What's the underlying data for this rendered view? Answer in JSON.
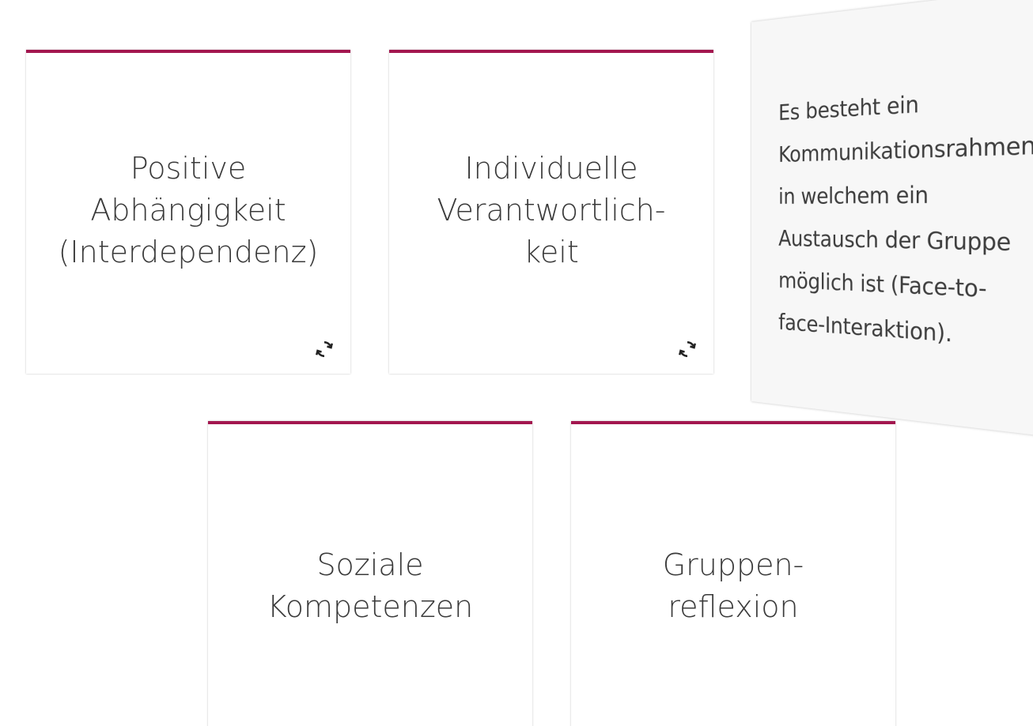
{
  "cards": [
    {
      "title": "Positive\nAbhängigkeit\n(Interdependenz)",
      "flip_icon": "refresh-icon"
    },
    {
      "title": "Individuelle\nVerantwortlich-\nkeit",
      "flip_icon": "refresh-icon"
    },
    {
      "back_text": "Es besteht ein Kommunikationsrahmen, in welchem ein Austausch der Gruppe möglich ist (Face-to-face-Interaktion).",
      "flip_icon": "refresh-icon"
    },
    {
      "title": "Soziale\nKompetenzen",
      "flip_icon": "refresh-icon"
    },
    {
      "title": "Gruppen-\nreflexion",
      "flip_icon": "refresh-icon"
    }
  ],
  "colors": {
    "accent": "#a3174f",
    "card_back": "#f7f7f7",
    "text": "#3a3a3a"
  }
}
